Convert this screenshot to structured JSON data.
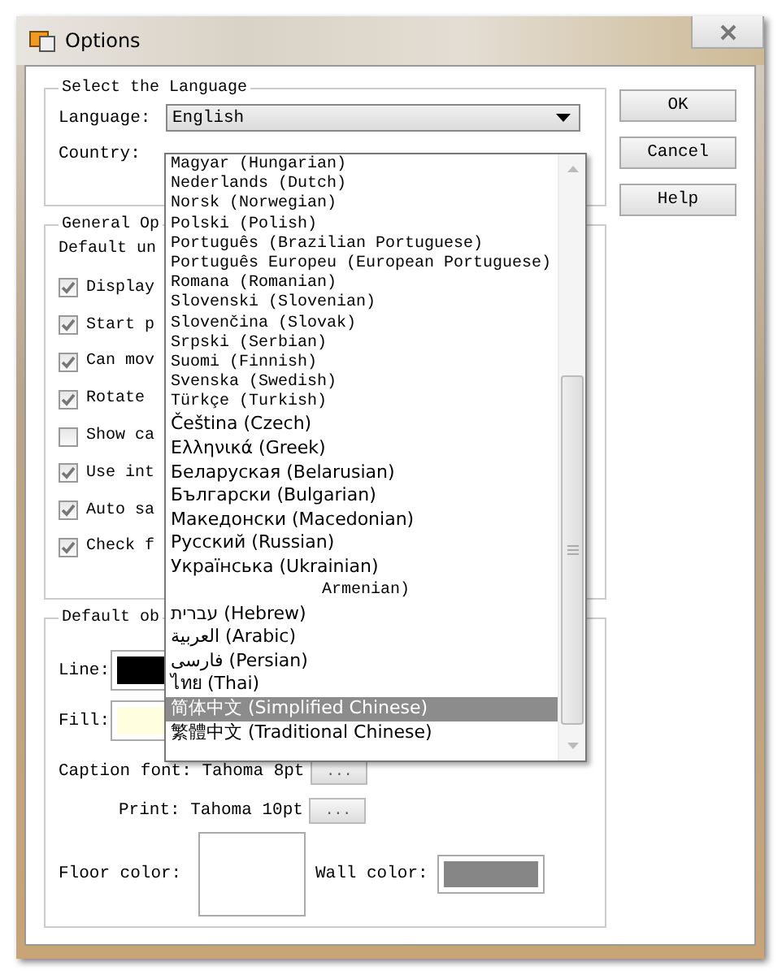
{
  "window": {
    "title": "Options"
  },
  "language_group": {
    "title": "Select the Language",
    "language_label": "Language:",
    "language_value": "English",
    "country_label": "Country:"
  },
  "buttons": [
    "OK",
    "Cancel",
    "Help"
  ],
  "general_group": {
    "title": "General Op",
    "units_label": "Default un",
    "options": [
      {
        "label": "Display",
        "checked": true
      },
      {
        "label": "Start p",
        "checked": true
      },
      {
        "label": "Can mov",
        "checked": true
      },
      {
        "label": "Rotate",
        "checked": true
      },
      {
        "label": "Show ca",
        "checked": false
      },
      {
        "label": "Use int",
        "checked": true
      },
      {
        "label": "Auto sa",
        "checked": true
      },
      {
        "label": "Check f",
        "checked": true
      }
    ]
  },
  "objects_group": {
    "title": "Default ob",
    "line": {
      "label": "Line:",
      "color": "#000000"
    },
    "fill": {
      "label": "Fill:",
      "color": "#ffffe0"
    },
    "caption_font": {
      "label": "Caption font: Tahoma 8pt",
      "button": "..."
    },
    "print_font": {
      "label": "Print: Tahoma 10pt",
      "button": "..."
    },
    "floor": {
      "label": "Floor color:",
      "color": "#ffffff"
    },
    "wall": {
      "label": "Wall color:",
      "color": "#868686"
    }
  },
  "language_list": {
    "items": [
      {
        "label": "Magyar (Hungarian)",
        "kind": "latin",
        "selected": false
      },
      {
        "label": "Nederlands (Dutch)",
        "kind": "latin",
        "selected": false
      },
      {
        "label": "Norsk (Norwegian)",
        "kind": "latin",
        "selected": false
      },
      {
        "label": "Polski (Polish)",
        "kind": "latin",
        "selected": false
      },
      {
        "label": "Português (Brazilian Portuguese)",
        "kind": "latin",
        "selected": false
      },
      {
        "label": "Português Europeu (European Portuguese)",
        "kind": "latin",
        "selected": false
      },
      {
        "label": "Romana (Romanian)",
        "kind": "latin",
        "selected": false
      },
      {
        "label": "Slovenski (Slovenian)",
        "kind": "latin",
        "selected": false
      },
      {
        "label": "Slovenčina (Slovak)",
        "kind": "latin",
        "selected": false
      },
      {
        "label": "Srpski (Serbian)",
        "kind": "latin",
        "selected": false
      },
      {
        "label": "Suomi (Finnish)",
        "kind": "latin",
        "selected": false
      },
      {
        "label": "Svenska (Swedish)",
        "kind": "latin",
        "selected": false
      },
      {
        "label": "Türkçe (Turkish)",
        "kind": "latin",
        "selected": false
      },
      {
        "label": "Čeština (Czech)",
        "kind": "native",
        "selected": false
      },
      {
        "label": "Ελληνικά (Greek)",
        "kind": "native",
        "selected": false
      },
      {
        "label": "Беларуская (Belarusian)",
        "kind": "native",
        "selected": false
      },
      {
        "label": "Български (Bulgarian)",
        "kind": "native",
        "selected": false
      },
      {
        "label": "Македонски (Macedonian)",
        "kind": "native",
        "selected": false
      },
      {
        "label": "Русский (Russian)",
        "kind": "native",
        "selected": false
      },
      {
        "label": "Українська (Ukrainian)",
        "kind": "native",
        "selected": false
      },
      {
        "label": "Armenian)",
        "kind": "indented",
        "selected": false
      },
      {
        "label": "עברית (Hebrew)",
        "kind": "native",
        "selected": false
      },
      {
        "label": "العربية (Arabic)",
        "kind": "native",
        "selected": false
      },
      {
        "label": "فارسی (Persian)",
        "kind": "native",
        "selected": false
      },
      {
        "label": "ไทย (Thai)",
        "kind": "native",
        "selected": false
      },
      {
        "label": "简体中文 (Simplified Chinese)",
        "kind": "native",
        "selected": true
      },
      {
        "label": "繁體中文 (Traditional Chinese)",
        "kind": "native",
        "selected": false
      }
    ]
  }
}
